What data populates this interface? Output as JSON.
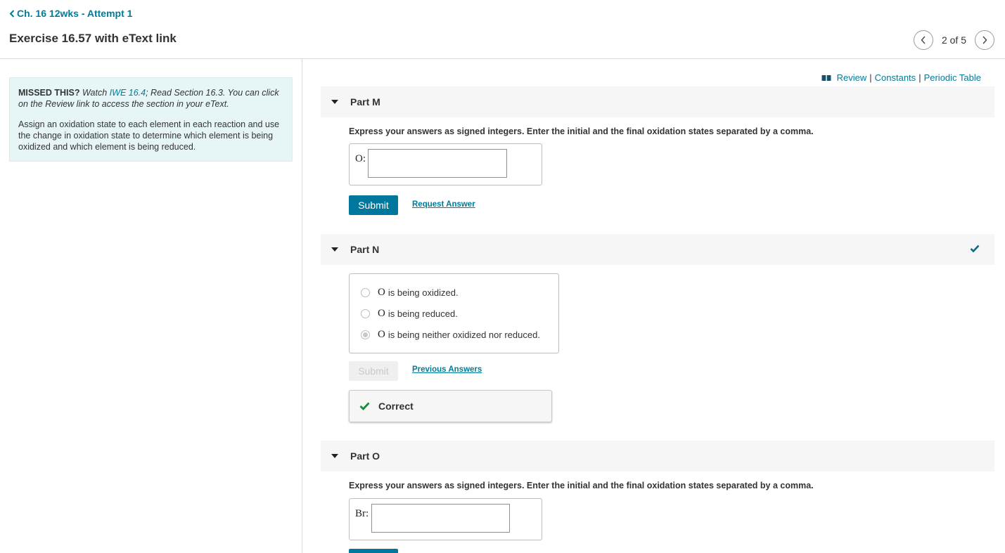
{
  "header": {
    "back_label": "Ch. 16 12wks - Attempt 1",
    "title": "Exercise 16.57 with eText link",
    "pager_text": "2 of 5"
  },
  "hint": {
    "missed_label": "MISSED THIS?",
    "watch_prefix": " Watch ",
    "watch_link": "IWE 16.4",
    "read_text": "; Read Section 16.3. You can click on the Review link to access the section in your eText.",
    "instructions": "Assign an oxidation state to each element in each reaction and use the change in oxidation state to determine which element is being oxidized and which element is being reduced."
  },
  "top_links": {
    "review": "Review",
    "separator": "|",
    "constants": "Constants",
    "periodic_table": "Periodic Table"
  },
  "parts": {
    "m": {
      "title": "Part M",
      "instructions": "Express your answers as signed integers. Enter the initial and the final oxidation states separated by a comma.",
      "var_label": "O:",
      "value": "",
      "submit_label": "Submit",
      "request_label": "Request Answer"
    },
    "n": {
      "title": "Part N",
      "choices": [
        {
          "element": "O",
          "text": "is being oxidized.",
          "selected": false
        },
        {
          "element": "O",
          "text": "is being reduced.",
          "selected": false
        },
        {
          "element": "O",
          "text": "is being neither oxidized nor reduced.",
          "selected": true
        }
      ],
      "submit_label": "Submit",
      "previous_label": "Previous Answers",
      "feedback": "Correct"
    },
    "o": {
      "title": "Part O",
      "instructions": "Express your answers as signed integers. Enter the initial and the final oxidation states separated by a comma.",
      "var_label": "Br:",
      "value": ""
    }
  },
  "colors": {
    "accent": "#007c99",
    "submit": "#00789d",
    "correct": "#1a8c3a",
    "hint_bg": "#e6f6f7"
  }
}
